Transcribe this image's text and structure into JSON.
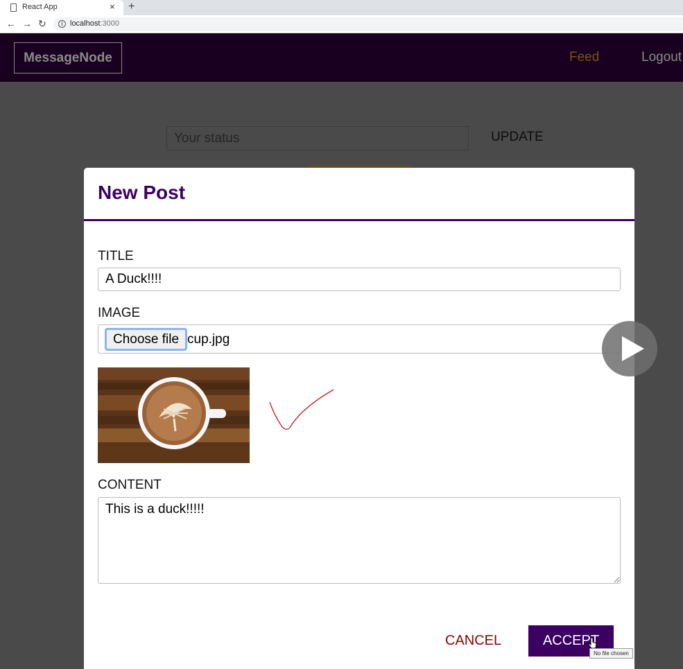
{
  "browser": {
    "tab_title": "React App",
    "tab_close": "×",
    "new_tab": "+",
    "url_host": "localhost",
    "url_port": ":3000",
    "back": "←",
    "forward": "→",
    "reload": "↻",
    "info": "i"
  },
  "header": {
    "logo": "MessageNode",
    "nav": {
      "feed": "Feed",
      "logout": "Logout"
    }
  },
  "status": {
    "placeholder": "Your status",
    "update_label": "UPDATE"
  },
  "modal": {
    "title": "New Post",
    "title_label": "TITLE",
    "title_value": "A Duck!!!!",
    "image_label": "IMAGE",
    "choose_file": "Choose file",
    "file_name": "cup.jpg",
    "content_label": "CONTENT",
    "content_value": "This is a duck!!!!!",
    "cancel_label": "CANCEL",
    "accept_label": "ACCEPT"
  },
  "tooltip": "No file chosen",
  "colors": {
    "header_bg": "#1a0020",
    "accent_purple": "#3b0062",
    "cancel_red": "#8b0000",
    "feed_gold": "#7a5410",
    "overlay": "#4a4a4a"
  },
  "icons": [
    "document-icon",
    "close-icon",
    "plus-icon",
    "back-arrow-icon",
    "forward-arrow-icon",
    "reload-icon",
    "info-icon",
    "checkmark-annotation-icon",
    "play-icon",
    "cursor-icon"
  ]
}
